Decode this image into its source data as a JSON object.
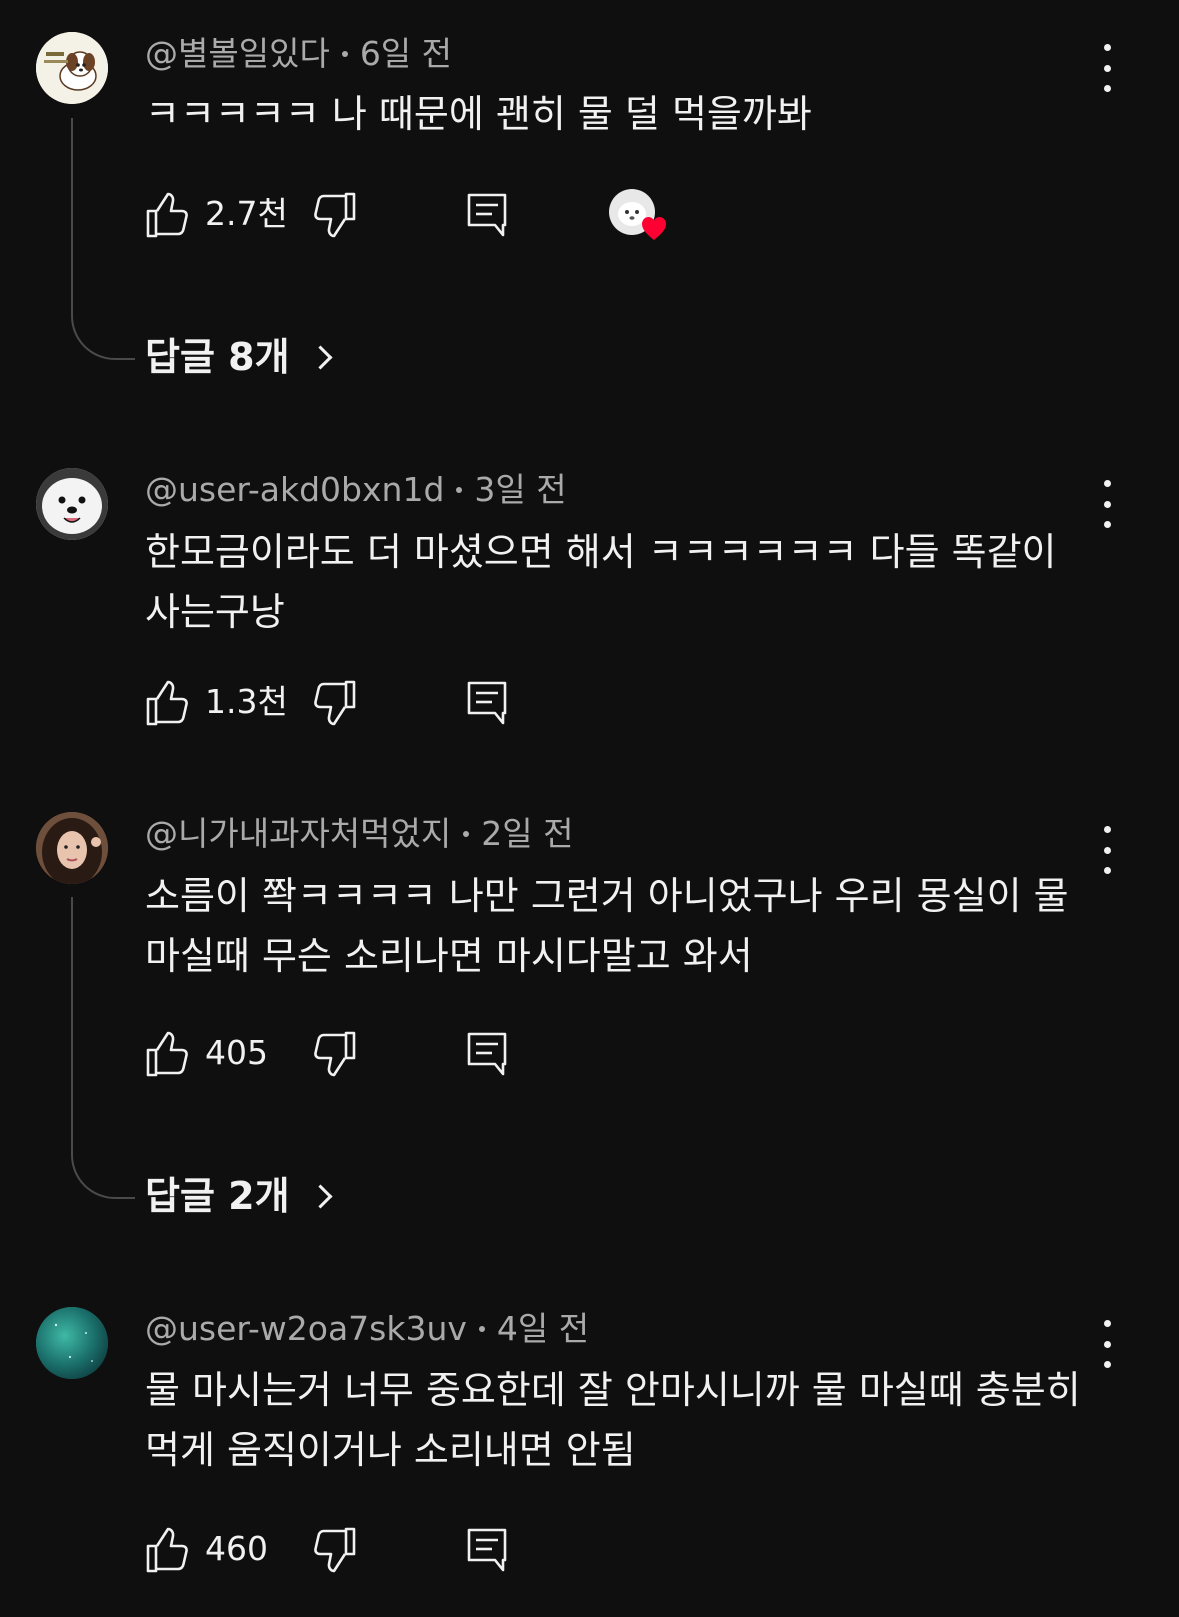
{
  "comments": [
    {
      "author": "@별볼일있다",
      "time": "6일 전",
      "text": "ㅋㅋㅋㅋㅋ 나 때문에 괜히 물 덜 먹을까봐",
      "likes": "2.7천",
      "creator_heart": true,
      "replies_label": "답글 8개",
      "avatar_icon": "dog-avatar-icon"
    },
    {
      "author": "@user-akd0bxn1d",
      "time": "3일 전",
      "text": "한모금이라도 더 마셨으면 해서 ㅋㅋㅋㅋㅋㅋ 다들 똑같이 사는구낭",
      "likes": "1.3천",
      "avatar_icon": "white-dog-avatar-icon"
    },
    {
      "author": "@니가내과자처먹었지",
      "time": "2일 전",
      "text": "소름이 쫙ㅋㅋㅋㅋ 나만 그런거 아니었구나 우리 몽실이 물마실때 무슨 소리나면 마시다말고 와서",
      "likes": "405",
      "replies_label": "답글 2개",
      "avatar_icon": "person-avatar-icon"
    },
    {
      "author": "@user-w2oa7sk3uv",
      "time": "4일 전",
      "text": "물 마시는거 너무 중요한데 잘 안마시니까 물 마실때 충분히 먹게 움직이거나 소리내면 안됨",
      "likes": "460",
      "avatar_icon": "teal-avatar-icon"
    }
  ],
  "colors": {
    "background": "#0f0f0f",
    "text": "#f1f1f1",
    "meta": "#aaaaaa",
    "heart": "#ff0033"
  }
}
